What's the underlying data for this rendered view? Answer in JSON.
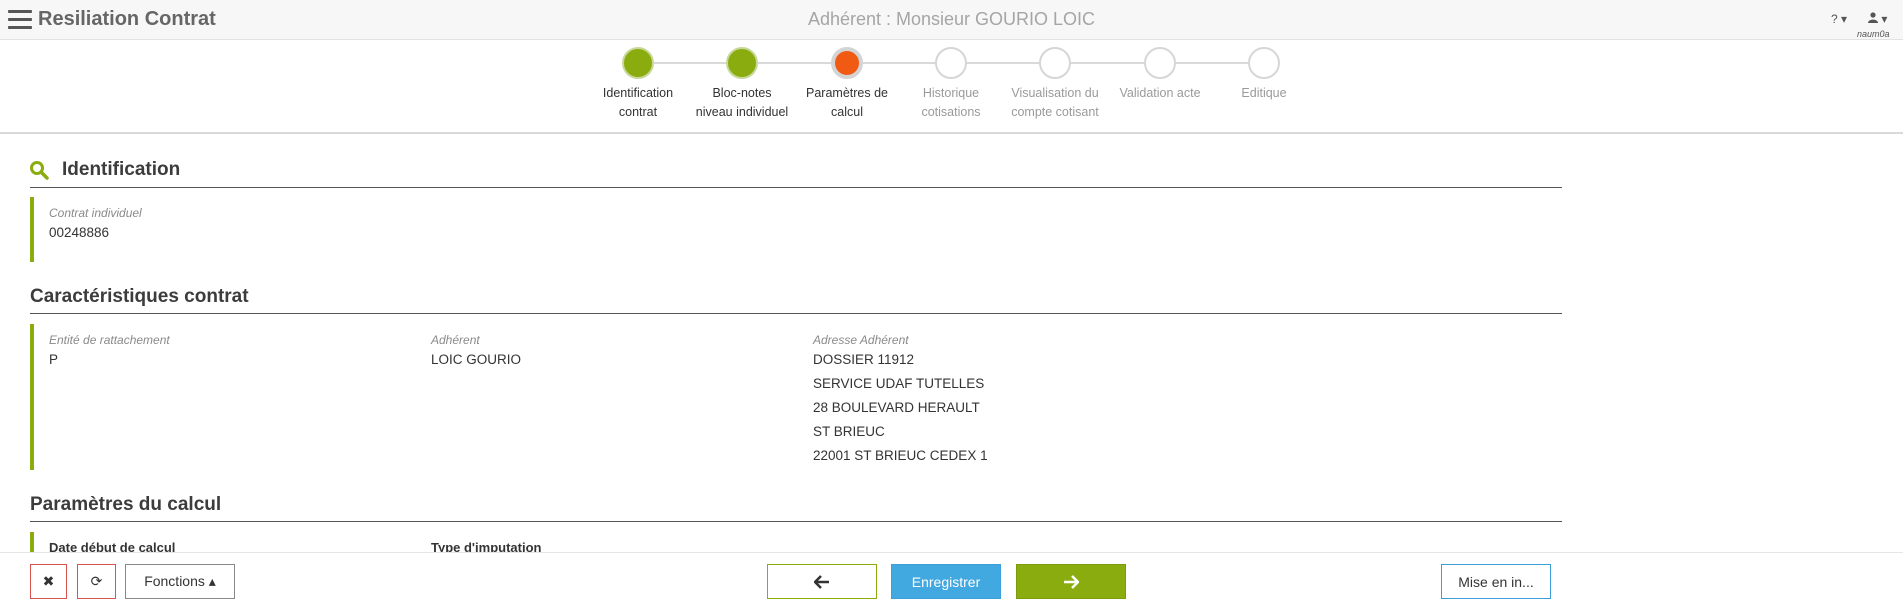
{
  "header": {
    "app_title": "Resiliation Contrat",
    "adherent_title": "Adhérent : Monsieur GOURIO LOIC",
    "help_label": "? ▾",
    "user_label": "▾",
    "username": "naum0a"
  },
  "stepper": {
    "steps": [
      {
        "line1": "Identification",
        "line2": "contrat",
        "state": "done"
      },
      {
        "line1": "Bloc-notes",
        "line2": "niveau individuel",
        "state": "done"
      },
      {
        "line1": "Paramètres de",
        "line2": "calcul",
        "state": "current"
      },
      {
        "line1": "Historique",
        "line2": "cotisations",
        "state": "todo"
      },
      {
        "line1": "Visualisation du",
        "line2": "compte cotisant",
        "state": "todo"
      },
      {
        "line1": "Validation acte",
        "line2": "",
        "state": "todo"
      },
      {
        "line1": "Editique",
        "line2": "",
        "state": "todo"
      }
    ]
  },
  "identification": {
    "title": "Identification",
    "contrat_label": "Contrat individuel",
    "contrat_value": "00248886"
  },
  "caracteristiques": {
    "title": "Caractéristiques contrat",
    "entite_label": "Entité de rattachement",
    "entite_value": "P",
    "adherent_label": "Adhérent",
    "adherent_value": "LOIC GOURIO",
    "adresse_label": "Adresse Adhérent",
    "adresse_lines": [
      "DOSSIER 11912",
      "SERVICE UDAF TUTELLES",
      "28 BOULEVARD HERAULT",
      "ST BRIEUC",
      "22001 ST BRIEUC CEDEX 1"
    ]
  },
  "parametres": {
    "title": "Paramètres du calcul",
    "date_debut_label": "Date début de calcul",
    "type_imputation_label": "Type d'imputation"
  },
  "footer": {
    "close_label": "✖",
    "refresh_label": "⟳",
    "fonctions_label": "Fonctions ▴",
    "prev_label": "🡐",
    "save_label": "Enregistrer",
    "next_label": "🡒",
    "mise_label": "Mise en in..."
  },
  "colors": {
    "accent_green": "#8aac0e",
    "current_orange": "#f05a12",
    "save_blue": "#42a8e0",
    "danger_red": "#d9534f"
  }
}
